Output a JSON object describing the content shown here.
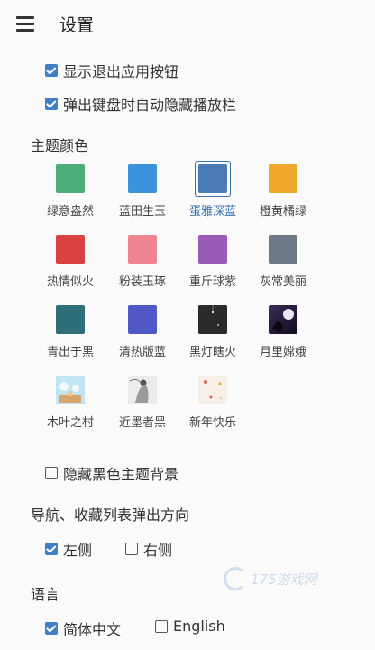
{
  "header": {
    "title": "设置",
    "menu_icon": "menu-icon"
  },
  "options": {
    "show_exit_button": {
      "label": "显示退出应用按钮",
      "checked": true
    },
    "auto_hide_player": {
      "label": "弹出键盘时自动隐藏播放栏",
      "checked": true
    }
  },
  "theme": {
    "section_title": "主题颜色",
    "tiles": [
      {
        "label": "绿意盎然",
        "color": "#4caf7a"
      },
      {
        "label": "蓝田生玉",
        "color": "#3d93db"
      },
      {
        "label": "蛋雅深蓝",
        "color": "#4a7ab5",
        "selected": true
      },
      {
        "label": "橙黄橘绿",
        "color": "#f0a72c"
      },
      {
        "label": "热情似火",
        "color": "#d94241"
      },
      {
        "label": "粉装玉琢",
        "color": "#ef8491"
      },
      {
        "label": "重斤球紫",
        "color": "#9a5ab8"
      },
      {
        "label": "灰常美丽",
        "color": "#6b7886"
      },
      {
        "label": "青出于黑",
        "color": "#2f6f7a"
      },
      {
        "label": "清热版蓝",
        "color": "#5058c8"
      },
      {
        "label": "黑灯瞎火",
        "color": "#2a2a2a",
        "icon": "dark-lamp-icon"
      },
      {
        "label": "月里嫦娥",
        "color": "#2a1d3e",
        "icon": "moon-fairy-icon"
      },
      {
        "label": "木叶之村",
        "color": "#a8d8ef",
        "icon": "leaf-village-icon"
      },
      {
        "label": "近墨者黑",
        "color": "#e6e6e6",
        "icon": "ink-figure-icon"
      },
      {
        "label": "新年快乐",
        "color": "#f4ede6",
        "icon": "new-year-icon"
      }
    ],
    "hide_black_bg": {
      "label": "隐藏黑色主题背景",
      "checked": false
    }
  },
  "nav_direction": {
    "section_title": "导航、收藏列表弹出方向",
    "left": {
      "label": "左侧",
      "checked": true
    },
    "right": {
      "label": "右侧",
      "checked": false
    }
  },
  "language": {
    "section_title": "语言",
    "zh": {
      "label": "简体中文",
      "checked": true
    },
    "en": {
      "label": "English",
      "checked": false
    }
  },
  "watermark": {
    "text": "175游戏网"
  }
}
